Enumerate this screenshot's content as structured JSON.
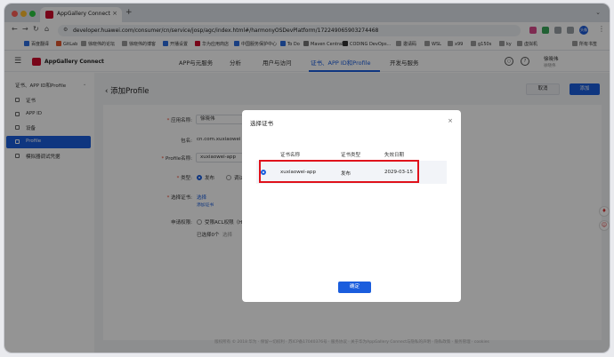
{
  "browser": {
    "tab_title": "AppGallery Connect",
    "tab_close": "×",
    "new_tab": "+",
    "tab_menu": "⌄",
    "nav_back": "←",
    "nav_forward": "→",
    "nav_reload": "↻",
    "nav_home": "⌂",
    "url": "developer.huawei.com/consumer/cn/service/josp/agc/index.html#/harmonyOSDevPlatform/172249065903274468",
    "avatar": "头像",
    "menu": "⋮"
  },
  "bookmarks": [
    "百度翻译",
    "GitLab",
    "徐晓伟的论坛",
    "徐晓伟的博客",
    "开播设置",
    "华为应用商店",
    "中国服务保护中心",
    "To Do",
    "Maven Central",
    "CODING DevOps...",
    "邀请码",
    "WSL",
    "x99",
    "g150s",
    "ky",
    "虚拟机"
  ],
  "bookmarks_all": "所有书签",
  "header": {
    "brand": "AppGallery Connect",
    "nav": [
      "APP与元服务",
      "分析",
      "用户与访问",
      "证书、APP ID和Profile",
      "开发与服务"
    ],
    "active_nav_index": 3,
    "user_name": "徐晓伟",
    "user_sub": "徐晓伟"
  },
  "sidebar": {
    "header": "证书、APP ID和Profile",
    "items": [
      "证书",
      "APP ID",
      "设备",
      "Profile",
      "模拟器调试凭据"
    ],
    "active_index": 3
  },
  "page": {
    "back_arrow": "‹",
    "title": "添加Profile",
    "cancel": "取消",
    "add": "添加"
  },
  "form": {
    "app_name_label": "应用名称:",
    "app_name_value": "徐晓伟",
    "package_label": "包名:",
    "package_value": "cn.com.xuxiaowei",
    "profile_name_label": "Profile名称:",
    "profile_name_value": "xuxiaowei-app",
    "type_label": "类型:",
    "type_release": "发布",
    "type_debug": "调试",
    "cert_label": "选择证书:",
    "cert_select": "选择",
    "cert_hint": "添加证书",
    "acl_label": "申请权限:",
    "acl_option": "受限ACL权限（Harm",
    "selected_count": "已选择0个",
    "selected_action": "选择"
  },
  "footer": "版权所有 © 2018 华为 · 保留一切权利 · 苏ICP备17040376号 · 服务协议 · 关于华为AppGallery Connect与隐私的声明 · 隐私政策 · 服务管理 · cookies",
  "modal": {
    "title": "选择证书",
    "close": "×",
    "columns": [
      "证书名称",
      "证书类型",
      "失效日期"
    ],
    "rows": [
      {
        "name": "xuxiaowei-app",
        "type": "发布",
        "expiry": "2029-03-15",
        "selected": true
      }
    ],
    "confirm": "确定"
  },
  "colors": {
    "accent": "#1a5ddd",
    "huawei_red": "#cf0a2c",
    "highlight_red": "#e0111b"
  }
}
